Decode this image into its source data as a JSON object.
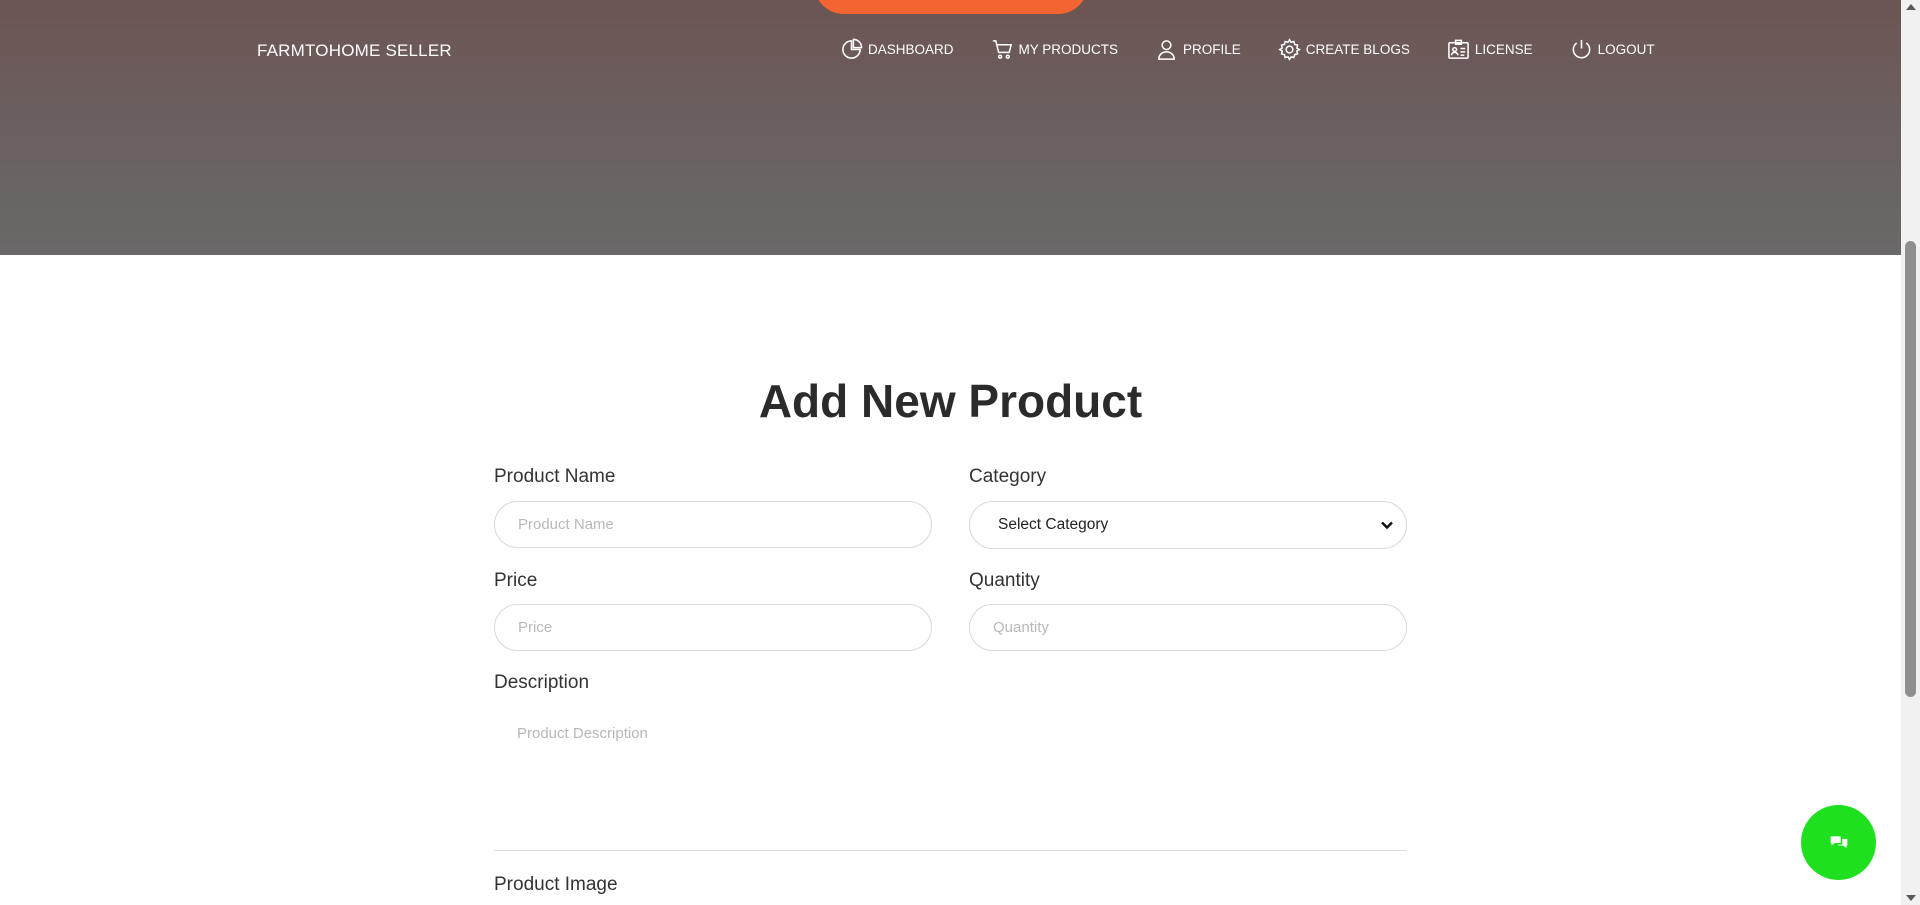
{
  "header": {
    "brand": "FARMTOHOME SELLER",
    "nav": [
      {
        "label": "DASHBOARD",
        "icon": "pie-chart-icon"
      },
      {
        "label": "MY PRODUCTS",
        "icon": "cart-icon"
      },
      {
        "label": "PROFILE",
        "icon": "user-icon"
      },
      {
        "label": "CREATE BLOGS",
        "icon": "gear-icon"
      },
      {
        "label": "LICENSE",
        "icon": "id-card-icon"
      },
      {
        "label": "LOGOUT",
        "icon": "power-icon"
      }
    ],
    "accent_color": "#f26430"
  },
  "form": {
    "title": "Add New Product",
    "product_name": {
      "label": "Product Name",
      "placeholder": "Product Name",
      "value": ""
    },
    "category": {
      "label": "Category",
      "selected": "Select Category"
    },
    "price": {
      "label": "Price",
      "placeholder": "Price",
      "value": ""
    },
    "quantity": {
      "label": "Quantity",
      "placeholder": "Quantity",
      "value": ""
    },
    "description": {
      "label": "Description",
      "placeholder": "Product Description",
      "value": ""
    },
    "image": {
      "label": "Product Image"
    }
  },
  "chat": {
    "icon": "chat-bubbles-icon",
    "color": "#1fe01f"
  }
}
